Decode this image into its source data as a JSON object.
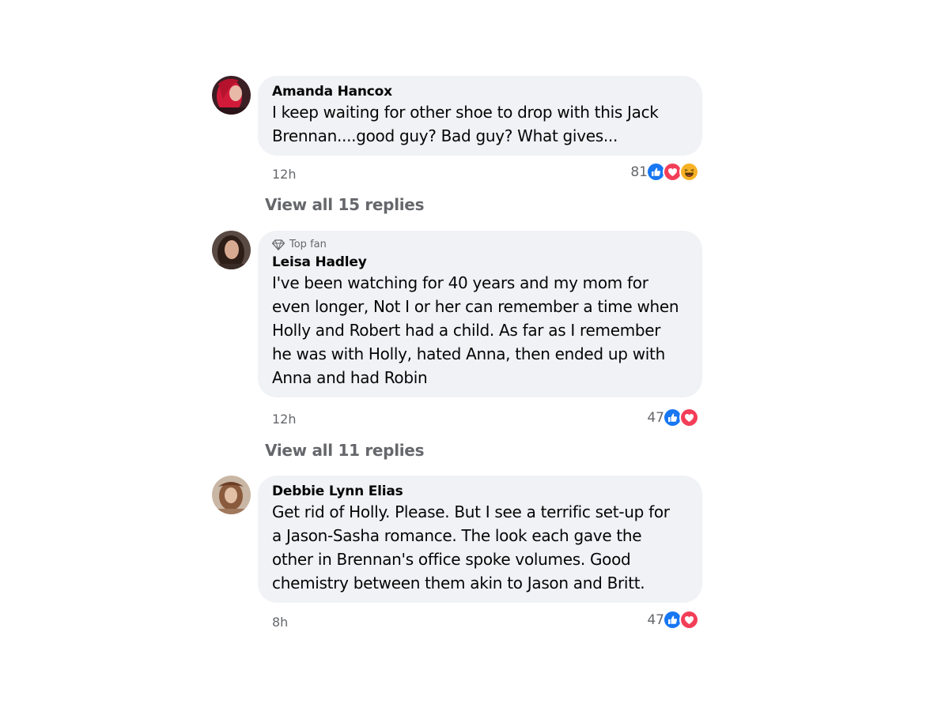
{
  "comments": [
    {
      "author": "Amanda Hancox",
      "badge": "",
      "text_lines": [
        "I keep waiting for other shoe to drop with this Jack",
        "Brennan....good guy? Bad guy? What gives..."
      ],
      "time": "12h",
      "reaction_count": "81",
      "reactions": [
        "like-icon",
        "love-icon",
        "haha-icon"
      ],
      "replies_label": "View all 15 replies"
    },
    {
      "author": "Leisa Hadley",
      "badge": "Top fan",
      "badge_icon": "diamond-icon",
      "text_lines": [
        "I've been watching for 40 years and my mom for",
        "even longer, Not I or her can remember a time when",
        "Holly and Robert had a child. As far as I remember",
        "he was with Holly, hated Anna, then ended up with",
        "Anna and had Robin"
      ],
      "time": "12h",
      "reaction_count": "47",
      "reactions": [
        "like-icon",
        "love-icon"
      ],
      "replies_label": "View all 11 replies"
    },
    {
      "author": "Debbie Lynn Elias",
      "badge": "",
      "text_lines": [
        "Get rid of Holly. Please. But I see a terrific set-up for",
        "a Jason-Sasha romance. The look each gave the",
        "other in Brennan's office spoke volumes. Good",
        "chemistry between them akin to Jason and Britt."
      ],
      "time": "8h",
      "reaction_count": "47",
      "reactions": [
        "like-icon",
        "love-icon"
      ],
      "replies_label": ""
    }
  ],
  "colors": {
    "bubble": "#f0f2f5",
    "secondary_text": "#65676b",
    "like": "#1877f2",
    "love": "#f33e58",
    "haha": "#f7b125"
  }
}
